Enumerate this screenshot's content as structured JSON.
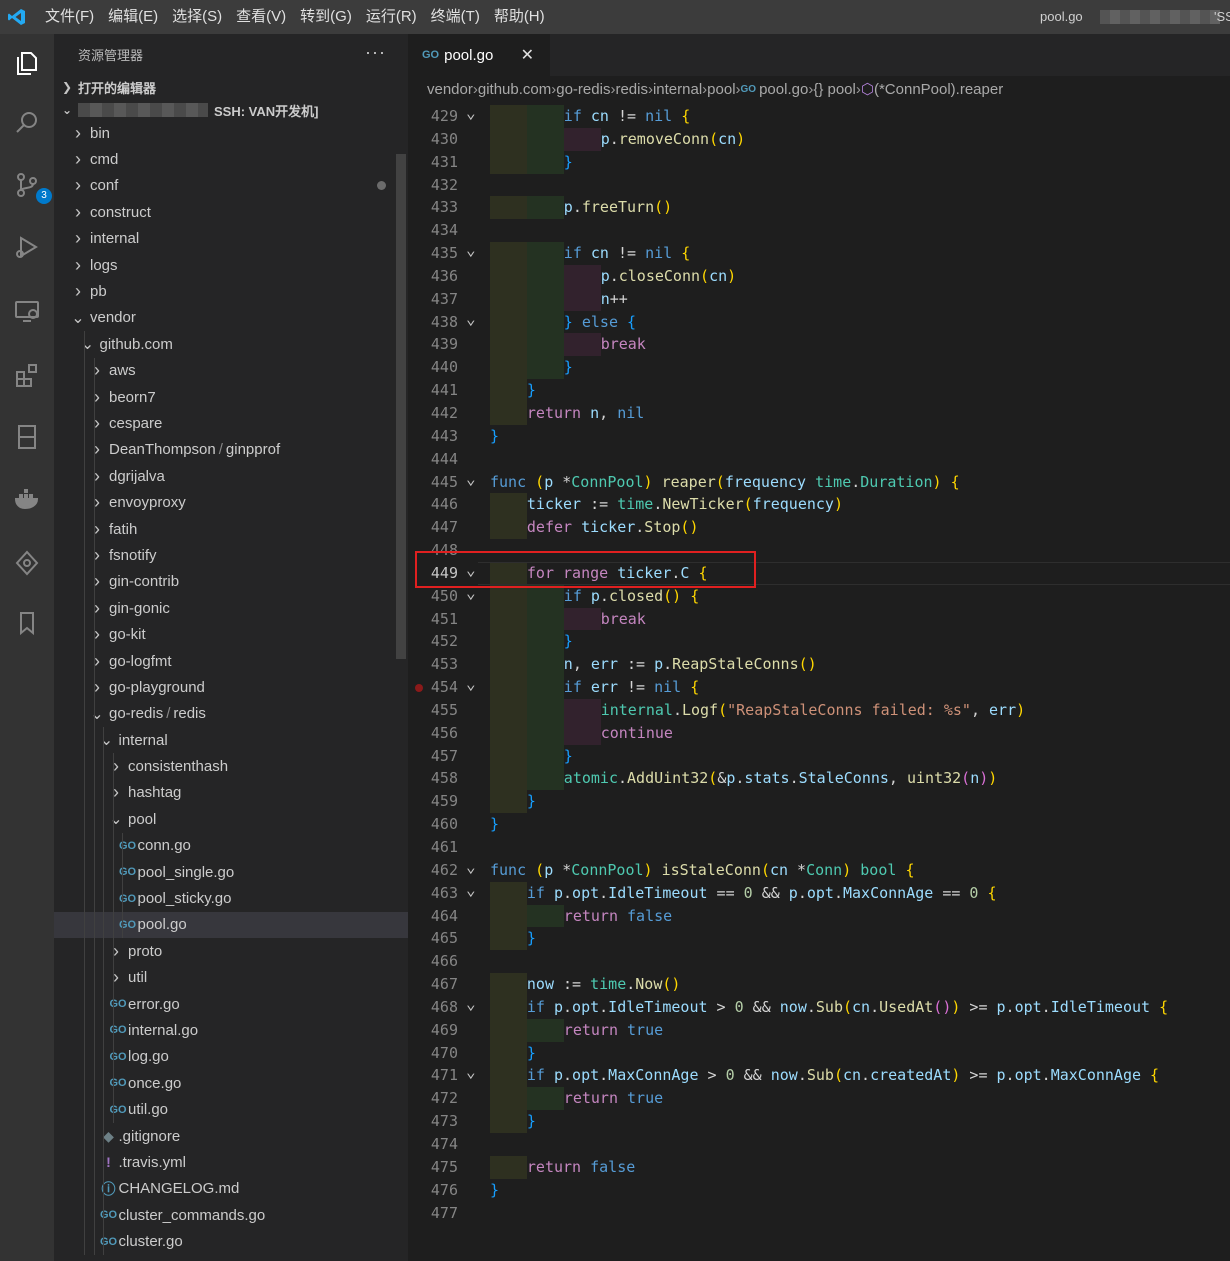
{
  "menu": [
    "文件(F)",
    "编辑(E)",
    "选择(S)",
    "查看(V)",
    "转到(G)",
    "运行(R)",
    "终端(T)",
    "帮助(H)"
  ],
  "window_title": "pool.go",
  "window_title_suffix": "'SS",
  "activity": {
    "icons": [
      "explorer-icon",
      "search-icon",
      "source-control-icon",
      "run-debug-icon",
      "remote-explorer-icon",
      "extensions-icon",
      "test-icon",
      "docker-icon",
      "gitlens-icon",
      "bookmarks-icon"
    ],
    "scm_badge": "3"
  },
  "sidebar": {
    "title": "资源管理器",
    "more": "···",
    "open_editors": "打开的编辑器",
    "workspace": "SSH: VAN开发机]",
    "tree": [
      {
        "label": "bin",
        "depth": 0,
        "kind": "folder",
        "open": false
      },
      {
        "label": "cmd",
        "depth": 0,
        "kind": "folder",
        "open": false
      },
      {
        "label": "conf",
        "depth": 0,
        "kind": "folder",
        "open": false,
        "modified": true
      },
      {
        "label": "construct",
        "depth": 0,
        "kind": "folder",
        "open": false
      },
      {
        "label": "internal",
        "depth": 0,
        "kind": "folder",
        "open": false
      },
      {
        "label": "logs",
        "depth": 0,
        "kind": "folder",
        "open": false
      },
      {
        "label": "pb",
        "depth": 0,
        "kind": "folder",
        "open": false
      },
      {
        "label": "vendor",
        "depth": 0,
        "kind": "folder",
        "open": true
      },
      {
        "label": "github.com",
        "depth": 1,
        "kind": "folder",
        "open": true
      },
      {
        "label": "aws",
        "depth": 2,
        "kind": "folder",
        "open": false
      },
      {
        "label": "beorn7",
        "depth": 2,
        "kind": "folder",
        "open": false
      },
      {
        "label": "cespare",
        "depth": 2,
        "kind": "folder",
        "open": false
      },
      {
        "label": "DeanThompson",
        "label2": "ginpprof",
        "depth": 2,
        "kind": "folder",
        "open": false
      },
      {
        "label": "dgrijalva",
        "depth": 2,
        "kind": "folder",
        "open": false
      },
      {
        "label": "envoyproxy",
        "depth": 2,
        "kind": "folder",
        "open": false
      },
      {
        "label": "fatih",
        "depth": 2,
        "kind": "folder",
        "open": false
      },
      {
        "label": "fsnotify",
        "depth": 2,
        "kind": "folder",
        "open": false
      },
      {
        "label": "gin-contrib",
        "depth": 2,
        "kind": "folder",
        "open": false
      },
      {
        "label": "gin-gonic",
        "depth": 2,
        "kind": "folder",
        "open": false
      },
      {
        "label": "go-kit",
        "depth": 2,
        "kind": "folder",
        "open": false
      },
      {
        "label": "go-logfmt",
        "depth": 2,
        "kind": "folder",
        "open": false
      },
      {
        "label": "go-playground",
        "depth": 2,
        "kind": "folder",
        "open": false
      },
      {
        "label": "go-redis",
        "label2": "redis",
        "depth": 2,
        "kind": "folder",
        "open": true
      },
      {
        "label": "internal",
        "depth": 3,
        "kind": "folder",
        "open": true
      },
      {
        "label": "consistenthash",
        "depth": 4,
        "kind": "folder",
        "open": false
      },
      {
        "label": "hashtag",
        "depth": 4,
        "kind": "folder",
        "open": false
      },
      {
        "label": "pool",
        "depth": 4,
        "kind": "folder",
        "open": true
      },
      {
        "label": "conn.go",
        "depth": 5,
        "kind": "go"
      },
      {
        "label": "pool_single.go",
        "depth": 5,
        "kind": "go"
      },
      {
        "label": "pool_sticky.go",
        "depth": 5,
        "kind": "go"
      },
      {
        "label": "pool.go",
        "depth": 5,
        "kind": "go",
        "selected": true
      },
      {
        "label": "proto",
        "depth": 4,
        "kind": "folder",
        "open": false
      },
      {
        "label": "util",
        "depth": 4,
        "kind": "folder",
        "open": false
      },
      {
        "label": "error.go",
        "depth": 4,
        "kind": "go"
      },
      {
        "label": "internal.go",
        "depth": 4,
        "kind": "go"
      },
      {
        "label": "log.go",
        "depth": 4,
        "kind": "go"
      },
      {
        "label": "once.go",
        "depth": 4,
        "kind": "go"
      },
      {
        "label": "util.go",
        "depth": 4,
        "kind": "go"
      },
      {
        "label": ".gitignore",
        "depth": 3,
        "kind": "gitignore"
      },
      {
        "label": ".travis.yml",
        "depth": 3,
        "kind": "yml"
      },
      {
        "label": "CHANGELOG.md",
        "depth": 3,
        "kind": "md"
      },
      {
        "label": "cluster_commands.go",
        "depth": 3,
        "kind": "go"
      },
      {
        "label": "cluster.go",
        "depth": 3,
        "kind": "go"
      }
    ]
  },
  "editor": {
    "tab": {
      "label": "pool.go",
      "close": "✕"
    },
    "breadcrumb": [
      "vendor",
      "github.com",
      "go-redis",
      "redis",
      "internal",
      "pool",
      "pool.go",
      "{} pool",
      "(*ConnPool).reaper"
    ],
    "current_line": 449,
    "lines": [
      {
        "n": 429,
        "fold": true,
        "code": "\t\tif cn != nil {"
      },
      {
        "n": 430,
        "fold": false,
        "code": "\t\t\tp.removeConn(cn)"
      },
      {
        "n": 431,
        "fold": false,
        "code": "\t\t}"
      },
      {
        "n": 432,
        "fold": false,
        "code": ""
      },
      {
        "n": 433,
        "fold": false,
        "code": "\t\tp.freeTurn()"
      },
      {
        "n": 434,
        "fold": false,
        "code": ""
      },
      {
        "n": 435,
        "fold": true,
        "code": "\t\tif cn != nil {"
      },
      {
        "n": 436,
        "fold": false,
        "code": "\t\t\tp.closeConn(cn)"
      },
      {
        "n": 437,
        "fold": false,
        "code": "\t\t\tn++"
      },
      {
        "n": 438,
        "fold": true,
        "code": "\t\t} else {"
      },
      {
        "n": 439,
        "fold": false,
        "code": "\t\t\tbreak"
      },
      {
        "n": 440,
        "fold": false,
        "code": "\t\t}"
      },
      {
        "n": 441,
        "fold": false,
        "code": "\t}"
      },
      {
        "n": 442,
        "fold": false,
        "code": "\treturn n, nil"
      },
      {
        "n": 443,
        "fold": false,
        "code": "}"
      },
      {
        "n": 444,
        "fold": false,
        "code": ""
      },
      {
        "n": 445,
        "fold": true,
        "code": "func (p *ConnPool) reaper(frequency time.Duration) {"
      },
      {
        "n": 446,
        "fold": false,
        "code": "\tticker := time.NewTicker(frequency)"
      },
      {
        "n": 447,
        "fold": false,
        "code": "\tdefer ticker.Stop()"
      },
      {
        "n": 448,
        "fold": false,
        "code": ""
      },
      {
        "n": 449,
        "fold": true,
        "code": "\tfor range ticker.C {"
      },
      {
        "n": 450,
        "fold": true,
        "code": "\t\tif p.closed() {"
      },
      {
        "n": 451,
        "fold": false,
        "code": "\t\t\tbreak"
      },
      {
        "n": 452,
        "fold": false,
        "code": "\t\t}"
      },
      {
        "n": 453,
        "fold": false,
        "code": "\t\tn, err := p.ReapStaleConns()"
      },
      {
        "n": 454,
        "fold": true,
        "code": "\t\tif err != nil {",
        "breakpoint": true
      },
      {
        "n": 455,
        "fold": false,
        "code": "\t\t\tinternal.Logf(\"ReapStaleConns failed: %s\", err)"
      },
      {
        "n": 456,
        "fold": false,
        "code": "\t\t\tcontinue"
      },
      {
        "n": 457,
        "fold": false,
        "code": "\t\t}"
      },
      {
        "n": 458,
        "fold": false,
        "code": "\t\tatomic.AddUint32(&p.stats.StaleConns, uint32(n))"
      },
      {
        "n": 459,
        "fold": false,
        "code": "\t}"
      },
      {
        "n": 460,
        "fold": false,
        "code": "}"
      },
      {
        "n": 461,
        "fold": false,
        "code": ""
      },
      {
        "n": 462,
        "fold": true,
        "code": "func (p *ConnPool) isStaleConn(cn *Conn) bool {"
      },
      {
        "n": 463,
        "fold": true,
        "code": "\tif p.opt.IdleTimeout == 0 && p.opt.MaxConnAge == 0 {"
      },
      {
        "n": 464,
        "fold": false,
        "code": "\t\treturn false"
      },
      {
        "n": 465,
        "fold": false,
        "code": "\t}"
      },
      {
        "n": 466,
        "fold": false,
        "code": ""
      },
      {
        "n": 467,
        "fold": false,
        "code": "\tnow := time.Now()"
      },
      {
        "n": 468,
        "fold": true,
        "code": "\tif p.opt.IdleTimeout > 0 && now.Sub(cn.UsedAt()) >= p.opt.IdleTimeout {"
      },
      {
        "n": 469,
        "fold": false,
        "code": "\t\treturn true"
      },
      {
        "n": 470,
        "fold": false,
        "code": "\t}"
      },
      {
        "n": 471,
        "fold": true,
        "code": "\tif p.opt.MaxConnAge > 0 && now.Sub(cn.createdAt) >= p.opt.MaxConnAge {"
      },
      {
        "n": 472,
        "fold": false,
        "code": "\t\treturn true"
      },
      {
        "n": 473,
        "fold": false,
        "code": "\t}"
      },
      {
        "n": 474,
        "fold": false,
        "code": ""
      },
      {
        "n": 475,
        "fold": false,
        "code": "\treturn false"
      },
      {
        "n": 476,
        "fold": false,
        "code": "}"
      },
      {
        "n": 477,
        "fold": false,
        "code": ""
      }
    ]
  }
}
